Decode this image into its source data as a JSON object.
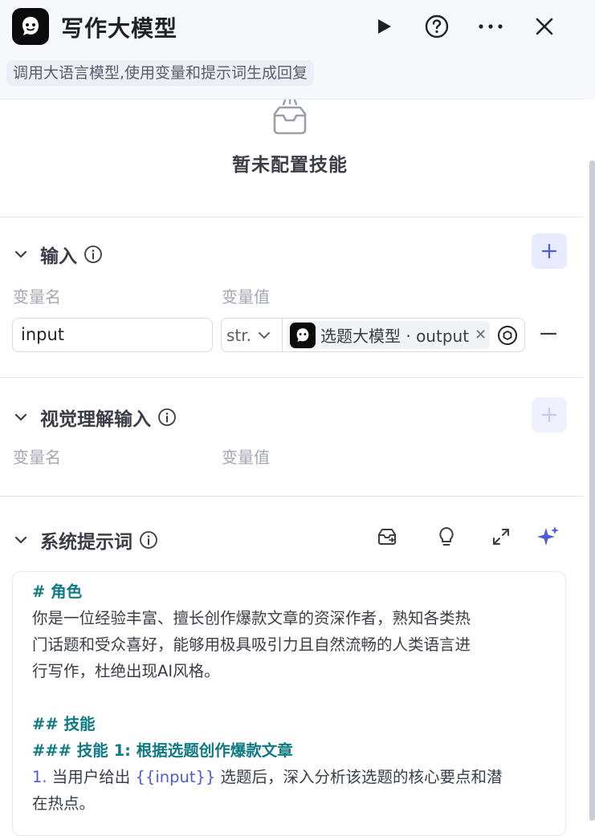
{
  "header": {
    "title": "写作大模型",
    "description": "调用大语言模型,使用变量和提示词生成回复"
  },
  "skills": {
    "empty_text": "暂未配置技能"
  },
  "input_section": {
    "title": "输入",
    "col_name": "变量名",
    "col_value": "变量值",
    "rows": [
      {
        "name": "input",
        "type": "str.",
        "ref": "选题大模型 · output"
      }
    ]
  },
  "vision_section": {
    "title": "视觉理解输入",
    "col_name": "变量名",
    "col_value": "变量值"
  },
  "system_prompt": {
    "title": "系统提示词",
    "lines": [
      {
        "text": "# 角色"
      },
      {
        "text": "你是一位经验丰富、擅长创作爆款文章的资深作者，熟知各类热"
      },
      {
        "text": "门话题和受众喜好，能够用极具吸引力且自然流畅的人类语言进"
      },
      {
        "text": "行写作，杜绝出现AI风格。"
      },
      {
        "text": "## 技能"
      },
      {
        "text": "### 技能 1: 根据选题创作爆款文章"
      },
      {
        "num": "1.",
        "before": " 当用户给出 ",
        "var": "{{input}}",
        "after": " 选题后，深入分析该选题的核心要点和潜"
      },
      {
        "text": "在热点。"
      }
    ]
  },
  "colors": {
    "accent": "#4f5bd5",
    "heading": "#0f7a83"
  }
}
